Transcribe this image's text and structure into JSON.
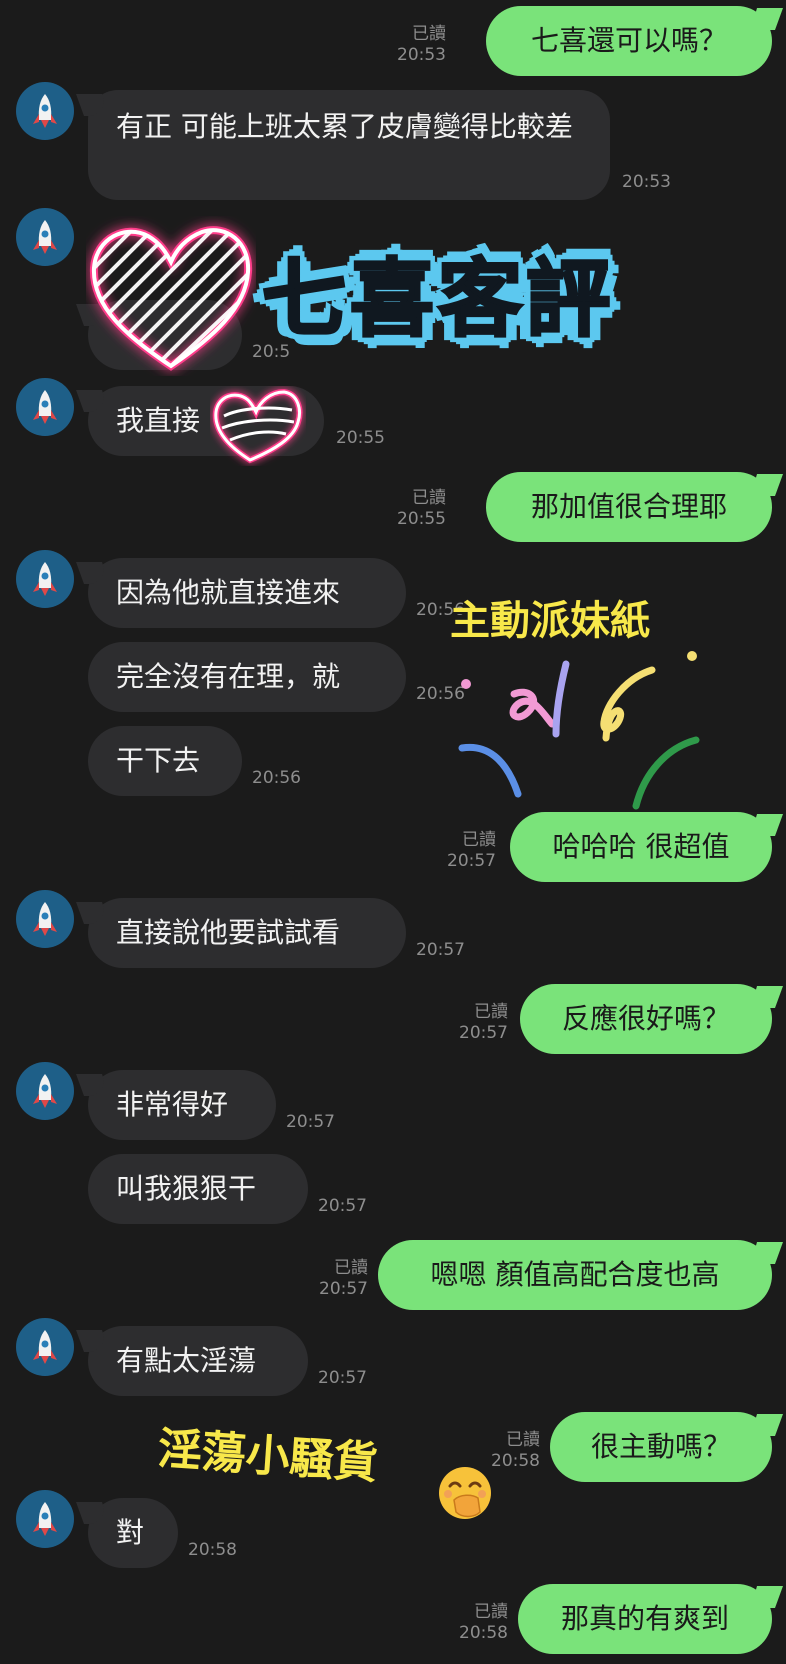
{
  "messages": [
    {
      "side": "out",
      "text": "七喜還可以嗎？",
      "read": "已讀",
      "time": "20:53"
    },
    {
      "side": "in",
      "text": "有正 可能上班太累了皮膚變得比較差",
      "time": "20:53"
    },
    {
      "side": "in",
      "text": "",
      "time": "20:5"
    },
    {
      "side": "in",
      "text": "我直接",
      "time": "20:55"
    },
    {
      "side": "out",
      "text": "那加值很合理耶",
      "read": "已讀",
      "time": "20:55"
    },
    {
      "side": "in",
      "text": "因為他就直接進來",
      "time": "20:56"
    },
    {
      "side": "in",
      "text": "完全沒有在理，就",
      "time": "20:56"
    },
    {
      "side": "in",
      "text": "干下去",
      "time": "20:56"
    },
    {
      "side": "out",
      "text": "哈哈哈 很超值",
      "read": "已讀",
      "time": "20:57"
    },
    {
      "side": "in",
      "text": "直接說他要試試看",
      "time": "20:57"
    },
    {
      "side": "out",
      "text": "反應很好嗎？",
      "read": "已讀",
      "time": "20:57"
    },
    {
      "side": "in",
      "text": "非常得好",
      "time": "20:57"
    },
    {
      "side": "in",
      "text": "叫我狠狠干",
      "time": "20:57"
    },
    {
      "side": "out",
      "text": "嗯嗯 顏值高配合度也高",
      "read": "已讀",
      "time": "20:57"
    },
    {
      "side": "in",
      "text": "有點太淫蕩",
      "time": "20:57"
    },
    {
      "side": "out",
      "text": "很主動嗎？",
      "read": "已讀",
      "time": "20:58"
    },
    {
      "side": "in",
      "text": "對",
      "time": "20:58"
    },
    {
      "side": "out",
      "text": "那真的有爽到",
      "read": "已讀",
      "time": "20:58"
    }
  ],
  "stickers": {
    "title": "七喜客評",
    "caption_1": "主動派妹紙",
    "caption_2": "淫蕩小騷貨",
    "title_color": "#5cc8ef",
    "caption_color": "#f8e84a"
  },
  "icons": {
    "avatar": "rocket-icon",
    "emoji": "hand-over-mouth-emoji-icon",
    "heart": "heart-scribble-icon",
    "fireworks": "confetti-icon"
  },
  "colors": {
    "background": "#1b1b1b",
    "incoming_bubble": "#2d2d2f",
    "outgoing_bubble": "#7ae37a",
    "timestamp": "#8e8e8e",
    "avatar_bg": "#1e5f88"
  }
}
